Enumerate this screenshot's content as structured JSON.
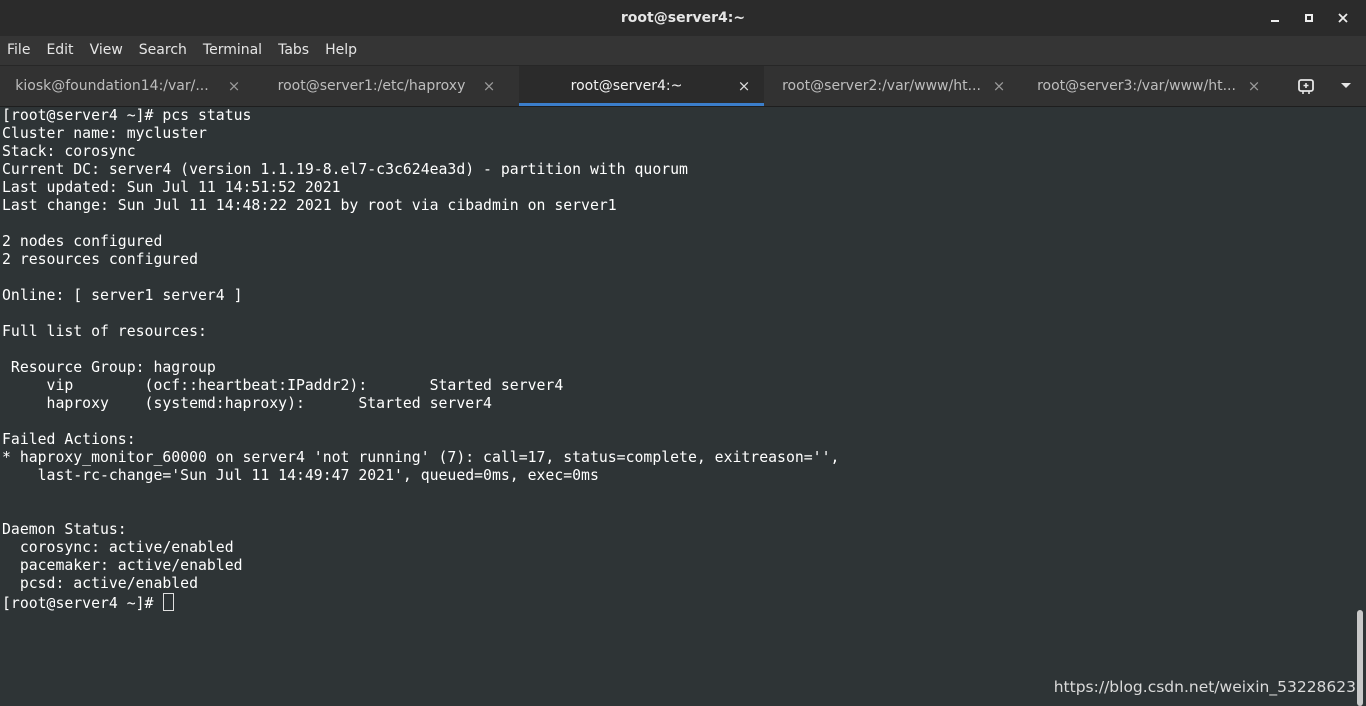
{
  "window": {
    "title": "root@server4:~",
    "controls": {
      "minimize": "‒",
      "maximize": "▪",
      "close": "✕"
    }
  },
  "menubar": {
    "items": [
      "File",
      "Edit",
      "View",
      "Search",
      "Terminal",
      "Tabs",
      "Help"
    ]
  },
  "tabs": [
    {
      "label": "kiosk@foundation14:/var/...",
      "close": "×",
      "active": false
    },
    {
      "label": "root@server1:/etc/haproxy",
      "close": "×",
      "active": false
    },
    {
      "label": "root@server4:~",
      "close": "×",
      "active": true
    },
    {
      "label": "root@server2:/var/www/ht...",
      "close": "×",
      "active": false
    },
    {
      "label": "root@server3:/var/www/ht...",
      "close": "×",
      "active": false
    }
  ],
  "tab_tools": {
    "new_tab_icon": "new-terminal-icon",
    "menu_icon": "dropdown-icon"
  },
  "terminal": {
    "lines": [
      "[root@server4 ~]# pcs status",
      "Cluster name: mycluster",
      "Stack: corosync",
      "Current DC: server4 (version 1.1.19-8.el7-c3c624ea3d) - partition with quorum",
      "Last updated: Sun Jul 11 14:51:52 2021",
      "Last change: Sun Jul 11 14:48:22 2021 by root via cibadmin on server1",
      "",
      "2 nodes configured",
      "2 resources configured",
      "",
      "Online: [ server1 server4 ]",
      "",
      "Full list of resources:",
      "",
      " Resource Group: hagroup",
      "     vip        (ocf::heartbeat:IPaddr2):       Started server4",
      "     haproxy    (systemd:haproxy):      Started server4",
      "",
      "Failed Actions:",
      "* haproxy_monitor_60000 on server4 'not running' (7): call=17, status=complete, exitreason='',",
      "    last-rc-change='Sun Jul 11 14:49:47 2021', queued=0ms, exec=0ms",
      "",
      "",
      "Daemon Status:",
      "  corosync: active/enabled",
      "  pacemaker: active/enabled",
      "  pcsd: active/enabled"
    ],
    "prompt": "[root@server4 ~]# "
  },
  "watermark": "https://blog.csdn.net/weixin_53228623",
  "colors": {
    "terminal_bg": "#2e3436",
    "terminal_fg": "#ffffff",
    "active_tab_indicator": "#3b7ecb"
  }
}
